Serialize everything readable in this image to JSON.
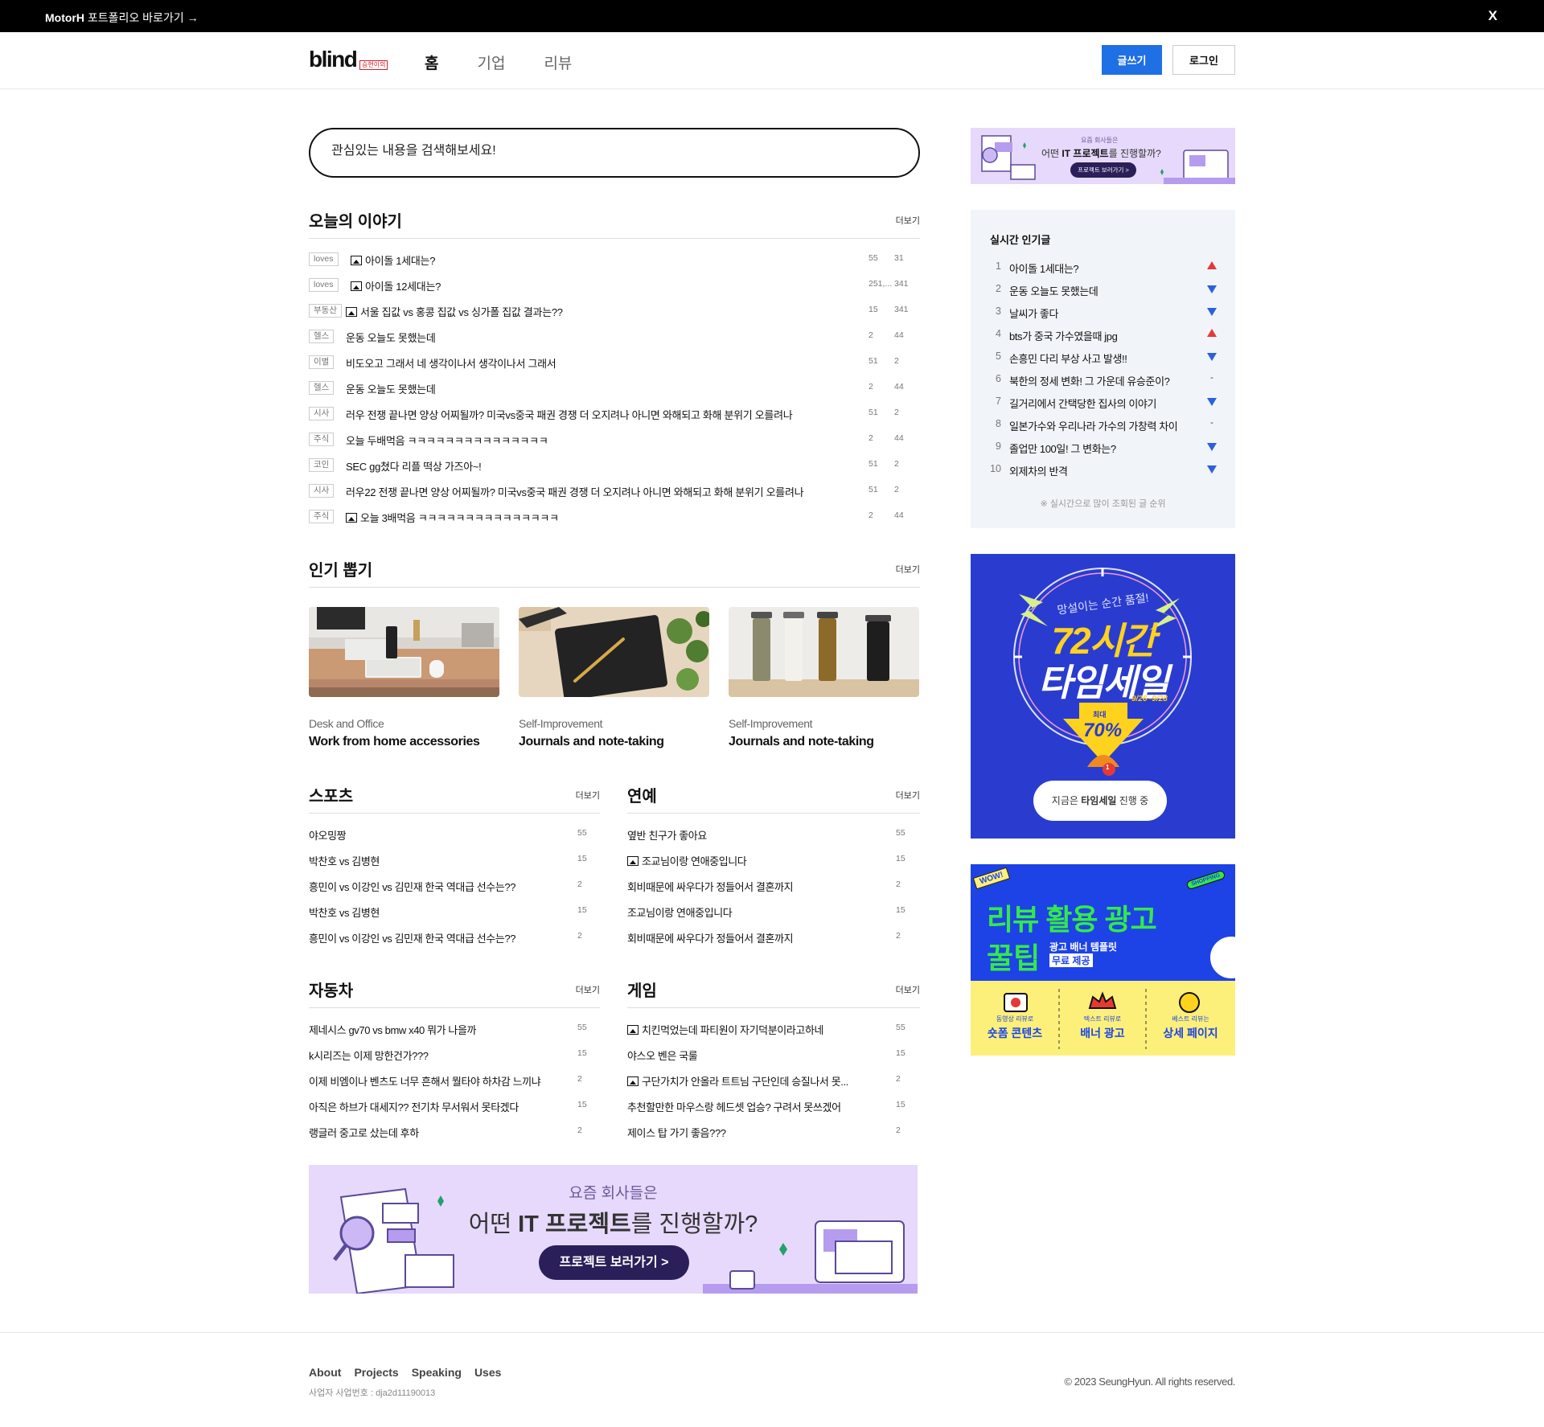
{
  "topbar": {
    "brand": "MotorH",
    "promo_text": " 포트폴리오 바로가기 →",
    "close_label": "X"
  },
  "header": {
    "logo": "blind",
    "logo_badge": "승현이의",
    "nav": [
      "홈",
      "기업",
      "리뷰"
    ],
    "write_label": "글쓰기",
    "login_label": "로그인"
  },
  "search": {
    "placeholder": "관심있는 내용을 검색해보세요!"
  },
  "today": {
    "title": "오늘의 이야기",
    "more": "더보기",
    "posts": [
      {
        "tag": "loves",
        "image": true,
        "title": "아이돌 1세대는?",
        "views": "55",
        "comments": "31"
      },
      {
        "tag": "loves",
        "image": true,
        "title": "아이돌 12세대는?",
        "views": "251,...",
        "comments": "341"
      },
      {
        "tag": "부동산",
        "image": true,
        "title": "서울 집값 vs 홍콩 집값 vs 싱가폴 집값 결과는??",
        "views": "15",
        "comments": "341"
      },
      {
        "tag": "헬스",
        "image": false,
        "title": "운동 오늘도 못했는데",
        "views": "2",
        "comments": "44"
      },
      {
        "tag": "이별",
        "image": false,
        "title": "비도오고 그래서 네 생각이나서 생각이나서 그래서",
        "views": "51",
        "comments": "2"
      },
      {
        "tag": "헬스",
        "image": false,
        "title": "운동 오늘도 못했는데",
        "views": "2",
        "comments": "44"
      },
      {
        "tag": "시사",
        "image": false,
        "title": "러우 전쟁 끝나면 양상 어찌될까? 미국vs중국 패권 경쟁 더 오지려나 아니면 와해되고 화해 분위기 오를려나",
        "views": "51",
        "comments": "2"
      },
      {
        "tag": "주식",
        "image": false,
        "title": "오늘 두배먹음 ㅋㅋㅋㅋㅋㅋㅋㅋㅋㅋㅋㅋㅋㅋㅋ",
        "views": "2",
        "comments": "44"
      },
      {
        "tag": "코인",
        "image": false,
        "title": "SEC gg쳤다 리플 떡상 가즈아~!",
        "views": "51",
        "comments": "2"
      },
      {
        "tag": "시사",
        "image": false,
        "title": "러우22 전쟁 끝나면 양상 어찌될까? 미국vs중국 패권 경쟁 더 오지려나 아니면 와해되고 화해 분위기 오를려나",
        "views": "51",
        "comments": "2"
      },
      {
        "tag": "주식",
        "image": true,
        "title": "오늘 3배먹음 ㅋㅋㅋㅋㅋㅋㅋㅋㅋㅋㅋㅋㅋㅋㅋ",
        "views": "2",
        "comments": "44"
      }
    ]
  },
  "popular": {
    "title": "인기 뽑기",
    "more": "더보기",
    "items": [
      {
        "category": "Desk and Office",
        "name": "Work from home accessories"
      },
      {
        "category": "Self-Improvement",
        "name": "Journals and note-taking"
      },
      {
        "category": "Self-Improvement",
        "name": "Journals and note-taking"
      }
    ]
  },
  "sports": {
    "title": "스포츠",
    "more": "더보기",
    "posts": [
      {
        "title": "야오밍짱",
        "count": "55",
        "image": false
      },
      {
        "title": "박찬호 vs 김병현",
        "count": "15",
        "image": false
      },
      {
        "title": "흥민이 vs 이강인 vs 김민재 한국 역대급 선수는??",
        "count": "2",
        "image": false
      },
      {
        "title": "박찬호 vs 김병현",
        "count": "15",
        "image": false
      },
      {
        "title": "흥민이 vs 이강인 vs 김민재 한국 역대급 선수는??",
        "count": "2",
        "image": false
      }
    ]
  },
  "entertainment": {
    "title": "연예",
    "more": "더보기",
    "posts": [
      {
        "title": "옆반 친구가 좋아요",
        "count": "55",
        "image": false
      },
      {
        "title": "조교님이랑 연애중입니다",
        "count": "15",
        "image": true
      },
      {
        "title": "회비때문에 싸우다가 정들어서 결혼까지",
        "count": "2",
        "image": false
      },
      {
        "title": "조교님이랑 연애중입니다",
        "count": "15",
        "image": false
      },
      {
        "title": "회비때문에 싸우다가 정들어서 결혼까지",
        "count": "2",
        "image": false
      }
    ]
  },
  "cars": {
    "title": "자동차",
    "more": "더보기",
    "posts": [
      {
        "title": "제네시스 gv70 vs bmw x40 뭐가 나을까",
        "count": "55",
        "image": false
      },
      {
        "title": "k시리즈는 이제 망한건가???",
        "count": "15",
        "image": false
      },
      {
        "title": "이제 비엠이나 벤츠도 너무 흔해서 뭘타야 하차감 느끼냐",
        "count": "2",
        "image": false
      },
      {
        "title": "아직은 하브가 대세지?? 전기차 무서워서 못타겠다",
        "count": "15",
        "image": false
      },
      {
        "title": "랭글러 중고로 샀는데 후하",
        "count": "2",
        "image": false
      }
    ]
  },
  "games": {
    "title": "게임",
    "more": "더보기",
    "posts": [
      {
        "title": "치킨먹었는데 파티원이 자기덕분이라고하네",
        "count": "55",
        "image": true
      },
      {
        "title": "야스오 벤은 국룰",
        "count": "15",
        "image": false
      },
      {
        "title": "구단가치가 안올라 트트님 구단인데 승질나서 못...",
        "count": "2",
        "image": true
      },
      {
        "title": "추천할만한 마우스랑 헤드셋 업승? 구려서 못쓰겠어",
        "count": "15",
        "image": false
      },
      {
        "title": "제이스 탑 가기 좋음???",
        "count": "2",
        "image": false
      }
    ]
  },
  "ad_top": {
    "line1": "요즘 회사들은",
    "line2_a": "어떤 ",
    "line2_b": "IT 프로젝트",
    "line2_c": "를 진행할까?",
    "button": "프로젝트 보러가기 >"
  },
  "realtime": {
    "title": "실시간 인기글",
    "note": "※ 실시간으로 많이 조회된 글 순위",
    "items": [
      {
        "rank": "1",
        "title": "아이돌 1세대는?",
        "trend": "up"
      },
      {
        "rank": "2",
        "title": "운동 오늘도 못했는데",
        "trend": "down"
      },
      {
        "rank": "3",
        "title": "날씨가 좋다",
        "trend": "down"
      },
      {
        "rank": "4",
        "title": "bts가 중국 가수였을때 jpg",
        "trend": "up"
      },
      {
        "rank": "5",
        "title": "손흥민 다리 부상 사고 발생!!",
        "trend": "down"
      },
      {
        "rank": "6",
        "title": "북한의 정세 변화! 그 가운데 유승준이?",
        "trend": "same"
      },
      {
        "rank": "7",
        "title": "길거리에서 간택당한 집사의 이야기",
        "trend": "down"
      },
      {
        "rank": "8",
        "title": "일본가수와 우리나라 가수의 가창력 차이",
        "trend": "same"
      },
      {
        "rank": "9",
        "title": "졸업만 100일! 그 변화는?",
        "trend": "down"
      },
      {
        "rank": "10",
        "title": "외제차의 반격",
        "trend": "down"
      }
    ]
  },
  "ad_sale": {
    "tagline": "망설이는 순간 품절!",
    "title1": "72시간",
    "title2": "타임세일",
    "dates": "9/26~9/28",
    "max_label": "최대",
    "percent": "70%",
    "bell_count": "1",
    "pill_a": "지금은 ",
    "pill_b": "타임세일",
    "pill_c": " 진행 중"
  },
  "ad_review": {
    "wow": "WOW!",
    "shopping": "SHOPPING",
    "title1": "리뷰 활용 광고",
    "title2": "꿀팁",
    "sub1": "광고 배너 템플릿",
    "sub2": "무료 제공",
    "items": [
      {
        "small": "동영상 리뷰로",
        "big": "숏폼 콘텐츠"
      },
      {
        "small": "텍스트 리뷰로",
        "big": "배너 광고"
      },
      {
        "small": "베스트 리뷰는",
        "big": "상세 페이지"
      }
    ]
  },
  "ad_bottom": {
    "line1": "요즘 회사들은",
    "line2_a": "어떤 ",
    "line2_b": "IT 프로젝트",
    "line2_c": "를 진행할까?",
    "button": "프로젝트 보러가기 >"
  },
  "footer": {
    "links": [
      "About",
      "Projects",
      "Speaking",
      "Uses"
    ],
    "biz": "사업자 사업번호 : dja2d11190013",
    "copyright": "© 2023 SeungHyun. All rights reserved."
  },
  "colors": {
    "accent": "#1f6fe5",
    "up": "#e53935",
    "down": "#2962d9",
    "ad_purple": "#e6d9fb",
    "ad_navy": "#2a1f59",
    "sale_blue": "#2a3ccf",
    "review_blue": "#1d43e6",
    "review_green": "#35e84a",
    "review_yellow": "#fdf07a"
  }
}
